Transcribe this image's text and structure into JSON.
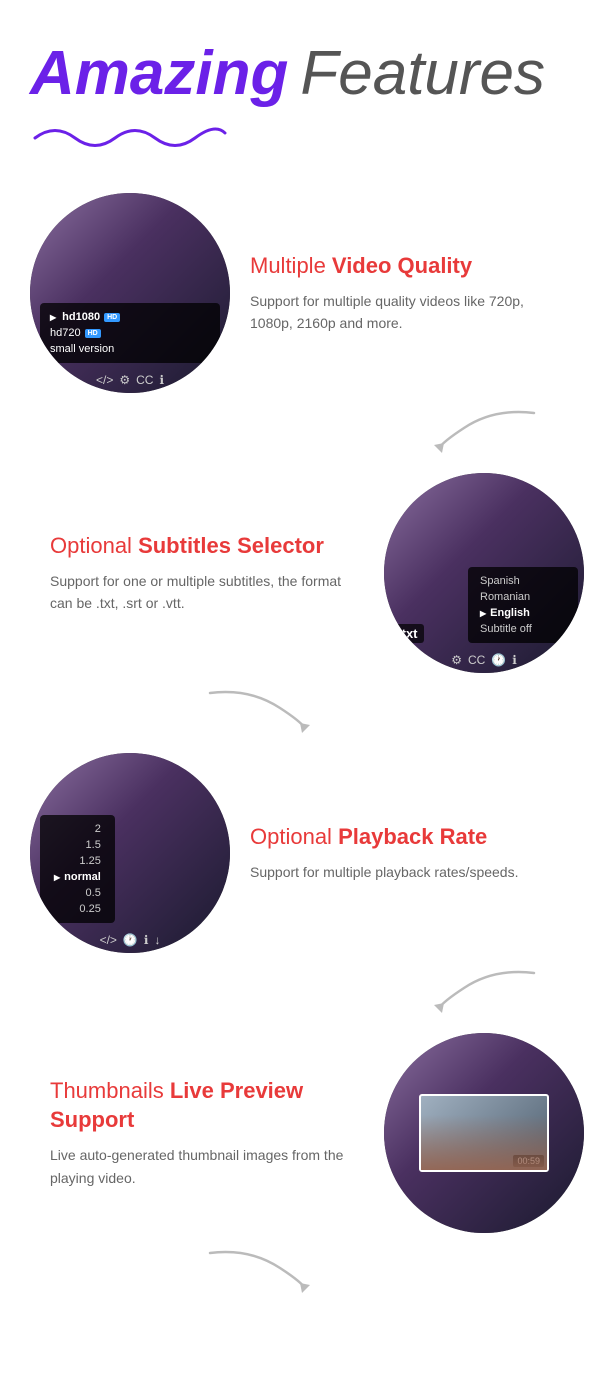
{
  "header": {
    "amazing": "Amazing",
    "features": "Features"
  },
  "features": [
    {
      "id": "video-quality",
      "layout": "left-image",
      "title_prefix": "Multiple ",
      "title_bold": "Video Quality",
      "description": "Support for multiple quality videos like 720p, 1080p, 2160p and more.",
      "quality_options": [
        {
          "label": "hd1080",
          "badge": "HD",
          "active": true
        },
        {
          "label": "hd720",
          "badge": "HD",
          "active": false
        },
        {
          "label": "small version",
          "badge": "",
          "active": false
        }
      ]
    },
    {
      "id": "subtitles",
      "layout": "right-image",
      "title_prefix": "Optional ",
      "title_bold": "Subtitles Selector",
      "description": "Support for one or multiple subtitles, the format can be .txt, .srt or .vtt.",
      "subtitle_options": [
        {
          "label": "Spanish",
          "active": false
        },
        {
          "label": "Romanian",
          "active": false
        },
        {
          "label": "English",
          "active": true
        },
        {
          "label": "Subtitle off",
          "active": false
        }
      ]
    },
    {
      "id": "playback-rate",
      "layout": "left-image",
      "title_prefix": "Optional ",
      "title_bold": "Playback Rate",
      "description": "Support for multiple playback rates/speeds.",
      "rate_options": [
        {
          "label": "2",
          "active": false
        },
        {
          "label": "1.5",
          "active": false
        },
        {
          "label": "1.25",
          "active": false
        },
        {
          "label": "normal",
          "active": true
        },
        {
          "label": "0.5",
          "active": false
        },
        {
          "label": "0.25",
          "active": false
        }
      ]
    },
    {
      "id": "thumbnails",
      "layout": "right-image",
      "title_prefix": "Thumbnails ",
      "title_bold": "Live Preview Support",
      "description": "Live auto-generated thumbnail images from the playing video.",
      "time_label": "00:59"
    }
  ]
}
